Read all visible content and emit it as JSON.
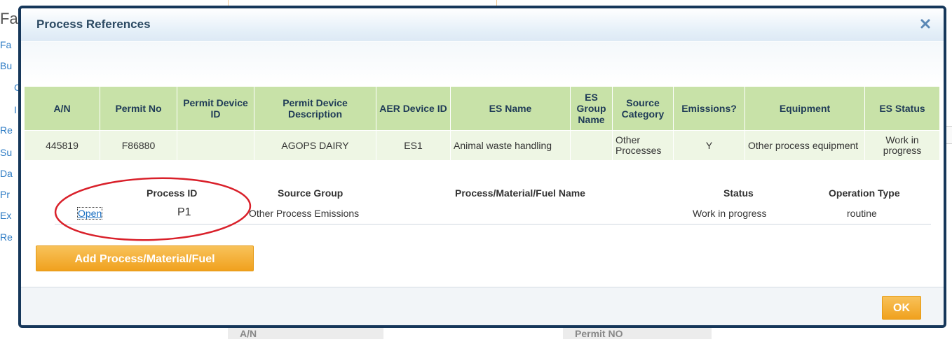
{
  "background": {
    "heading": "Fa",
    "links": [
      "Fa",
      "Bu",
      "C",
      "I",
      "Re",
      "Su",
      "Da",
      "Pr",
      "Ex",
      "Re"
    ],
    "bottom_cells": [
      "A/N",
      "Permit NO"
    ]
  },
  "dialog": {
    "title": "Process References",
    "close_label": "×",
    "es_table": {
      "headers": [
        "A/N",
        "Permit No",
        "Permit Device ID",
        "Permit Device Description",
        "AER Device ID",
        "ES Name",
        "ES Group Name",
        "Source Category",
        "Emissions?",
        "Equipment",
        "ES Status"
      ],
      "row": [
        "445819",
        "F86880",
        "",
        "AGOPS DAIRY",
        "ES1",
        "Animal waste handling",
        "",
        "Other Processes",
        "Y",
        "Other process equipment",
        "Work in progress"
      ]
    },
    "process_table": {
      "headers": {
        "process_id": "Process ID",
        "source_group": "Source Group",
        "name": "Process/Material/Fuel Name",
        "status": "Status",
        "operation_type": "Operation Type"
      },
      "row": {
        "open": "Open",
        "process_id": "P1",
        "source_group": "Other Process Emissions",
        "name": "",
        "status": "Work in progress",
        "operation_type": "routine"
      }
    },
    "add_button": "Add Process/Material/Fuel",
    "ok_button": "OK"
  },
  "colors": {
    "dialog_border": "#16375a",
    "table_header": "#c8e2a8",
    "table_row": "#eef6e4",
    "button": "#f0a11e",
    "annotation": "#d9202a"
  }
}
